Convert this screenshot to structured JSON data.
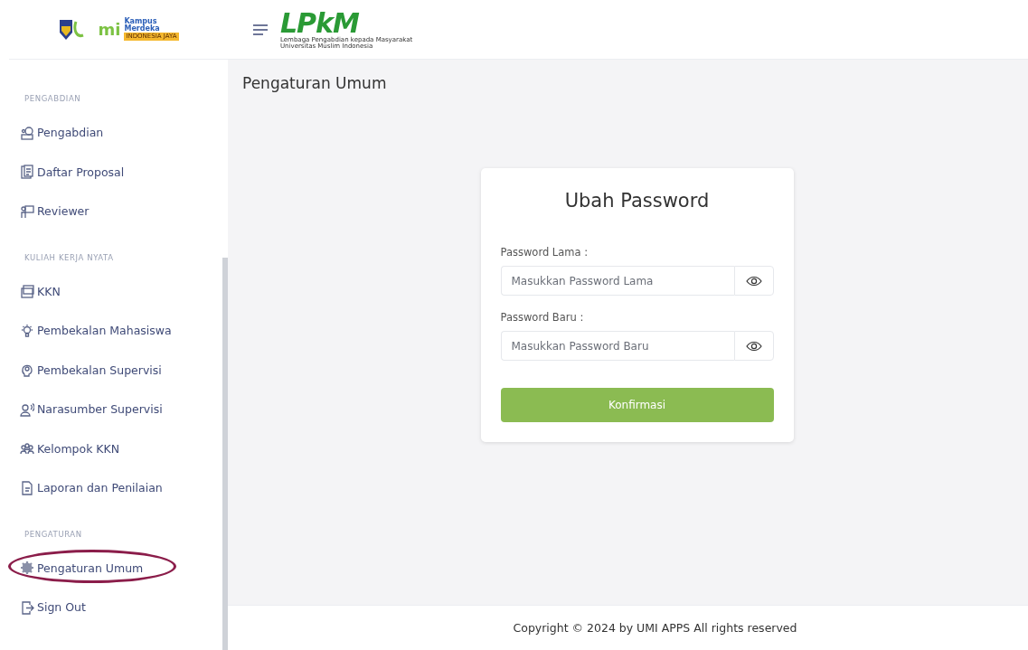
{
  "header": {
    "left_logo": {
      "text": "mi",
      "partner_top": "Kampus",
      "partner_bottom": "Merdeka",
      "partner_strip": "INDONESIA JAYA"
    },
    "brand_logo": {
      "text": "LPkM",
      "subtitle_1": "Lembaga Pengabdian kepada Masyarakat",
      "subtitle_2": "Universitas Muslim Indonesia"
    }
  },
  "sidebar": {
    "sections": [
      {
        "title": "PENGABDIAN",
        "items": [
          {
            "label": "Pengabdian",
            "circled": false
          },
          {
            "label": "Daftar Proposal",
            "circled": false
          },
          {
            "label": "Reviewer",
            "circled": false
          }
        ]
      },
      {
        "title": "KULIAH KERJA NYATA",
        "items": [
          {
            "label": "KKN",
            "circled": false
          },
          {
            "label": "Pembekalan Mahasiswa",
            "circled": false
          },
          {
            "label": "Pembekalan Supervisi",
            "circled": false
          },
          {
            "label": "Narasumber Supervisi",
            "circled": false
          },
          {
            "label": "Kelompok KKN",
            "circled": false
          },
          {
            "label": "Laporan dan Penilaian",
            "circled": false
          }
        ]
      },
      {
        "title": "PENGATURAN",
        "items": [
          {
            "label": "Pengaturan Umum",
            "circled": true
          },
          {
            "label": "Sign Out",
            "circled": false
          }
        ]
      }
    ]
  },
  "page_title": "Pengaturan Umum",
  "card": {
    "title": "Ubah Password",
    "fields": [
      {
        "label": "Password Lama :",
        "placeholder": "Masukkan Password Lama"
      },
      {
        "label": "Password Baru :",
        "placeholder": "Masukkan Password Baru"
      }
    ],
    "button": "Konfirmasi"
  },
  "footer": "Copyright © 2024 by UMI APPS All rights reserved"
}
